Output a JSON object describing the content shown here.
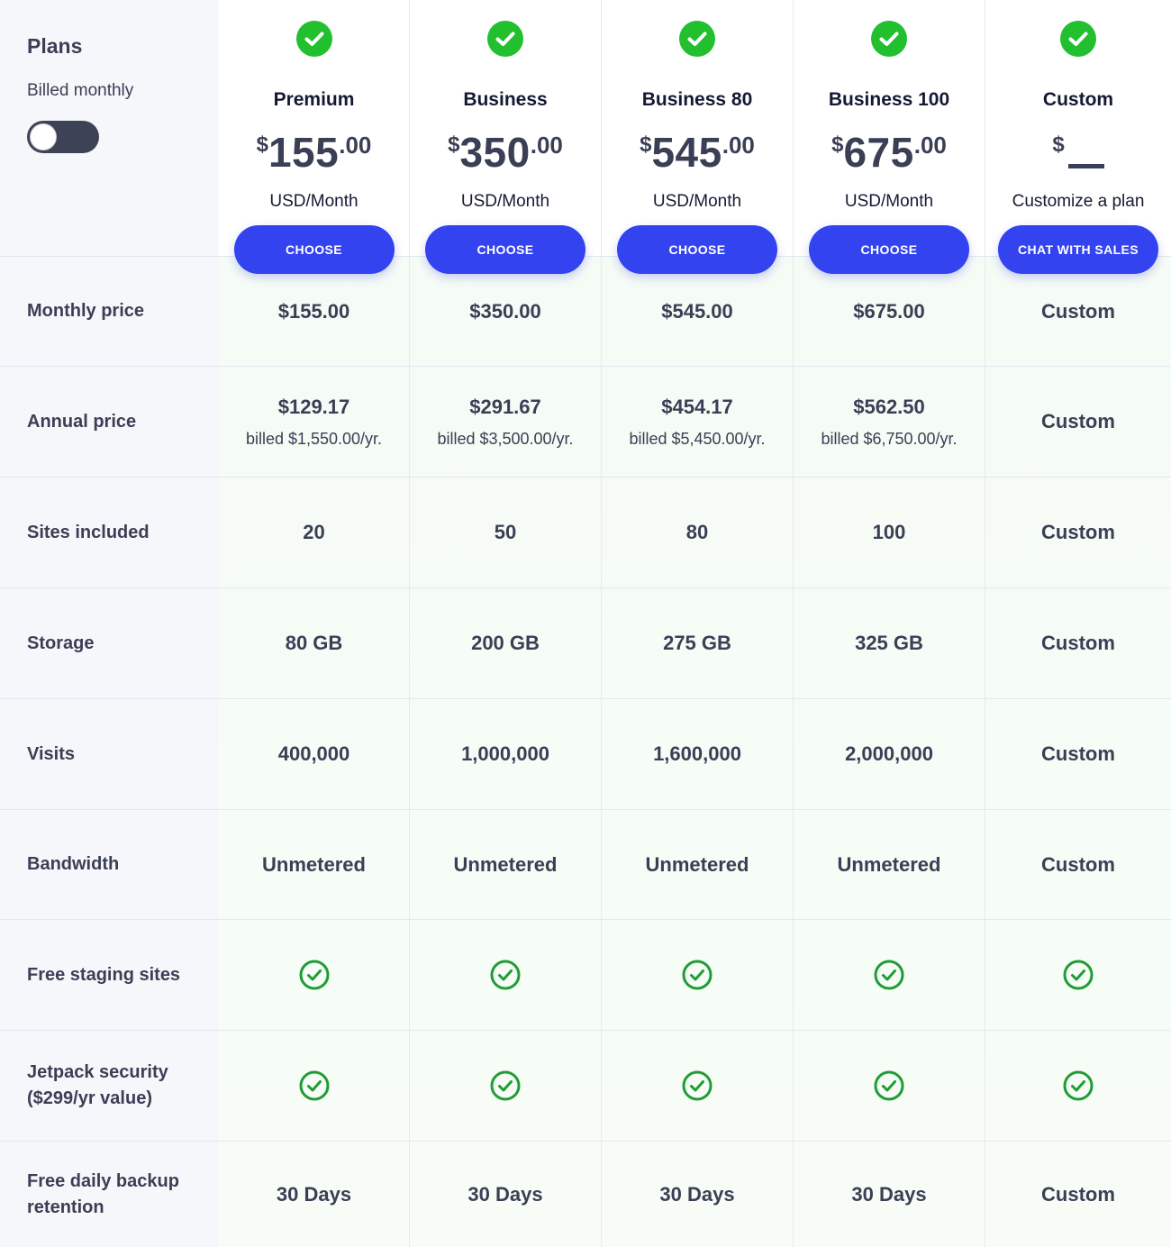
{
  "header": {
    "title": "Plans",
    "billing_label": "Billed monthly",
    "toggle_state": "monthly"
  },
  "colors": {
    "accent": "#3443f0",
    "check_green": "#22c02e",
    "text": "#3a3f55",
    "heading": "#151a33"
  },
  "plans": [
    {
      "name": "Premium",
      "currency": "$",
      "amount": "155",
      "decimals": ".00",
      "unit": "USD/Month",
      "button": "CHOOSE"
    },
    {
      "name": "Business",
      "currency": "$",
      "amount": "350",
      "decimals": ".00",
      "unit": "USD/Month",
      "button": "CHOOSE"
    },
    {
      "name": "Business 80",
      "currency": "$",
      "amount": "545",
      "decimals": ".00",
      "unit": "USD/Month",
      "button": "CHOOSE"
    },
    {
      "name": "Business 100",
      "currency": "$",
      "amount": "675",
      "decimals": ".00",
      "unit": "USD/Month",
      "button": "CHOOSE"
    },
    {
      "name": "Custom",
      "currency": "$",
      "amount": "",
      "decimals": "",
      "unit": "Customize a plan",
      "button": "CHAT WITH SALES"
    }
  ],
  "rows": [
    {
      "label": "Monthly price",
      "cells": [
        {
          "main": "$155.00"
        },
        {
          "main": "$350.00"
        },
        {
          "main": "$545.00"
        },
        {
          "main": "$675.00"
        },
        {
          "main": "Custom"
        }
      ]
    },
    {
      "label": "Annual price",
      "cells": [
        {
          "main": "$129.17",
          "sub": "billed $1,550.00/yr."
        },
        {
          "main": "$291.67",
          "sub": "billed $3,500.00/yr."
        },
        {
          "main": "$454.17",
          "sub": "billed $5,450.00/yr."
        },
        {
          "main": "$562.50",
          "sub": "billed $6,750.00/yr."
        },
        {
          "main": "Custom"
        }
      ]
    },
    {
      "label": "Sites included",
      "cells": [
        {
          "main": "20"
        },
        {
          "main": "50"
        },
        {
          "main": "80"
        },
        {
          "main": "100"
        },
        {
          "main": "Custom"
        }
      ]
    },
    {
      "label": "Storage",
      "cells": [
        {
          "main": "80 GB"
        },
        {
          "main": "200 GB"
        },
        {
          "main": "275 GB"
        },
        {
          "main": "325 GB"
        },
        {
          "main": "Custom"
        }
      ]
    },
    {
      "label": "Visits",
      "cells": [
        {
          "main": "400,000"
        },
        {
          "main": "1,000,000"
        },
        {
          "main": "1,600,000"
        },
        {
          "main": "2,000,000"
        },
        {
          "main": "Custom"
        }
      ]
    },
    {
      "label": "Bandwidth",
      "cells": [
        {
          "main": "Unmetered"
        },
        {
          "main": "Unmetered"
        },
        {
          "main": "Unmetered"
        },
        {
          "main": "Unmetered"
        },
        {
          "main": "Custom"
        }
      ]
    },
    {
      "label": "Free staging sites",
      "cells": [
        {
          "check": true
        },
        {
          "check": true
        },
        {
          "check": true
        },
        {
          "check": true
        },
        {
          "check": true
        }
      ]
    },
    {
      "label": "Jetpack security ($299/yr value)",
      "cells": [
        {
          "check": true
        },
        {
          "check": true
        },
        {
          "check": true
        },
        {
          "check": true
        },
        {
          "check": true
        }
      ]
    },
    {
      "label": "Free daily backup retention",
      "cells": [
        {
          "main": "30 Days"
        },
        {
          "main": "30 Days"
        },
        {
          "main": "30 Days"
        },
        {
          "main": "30 Days"
        },
        {
          "main": "Custom"
        }
      ]
    }
  ]
}
